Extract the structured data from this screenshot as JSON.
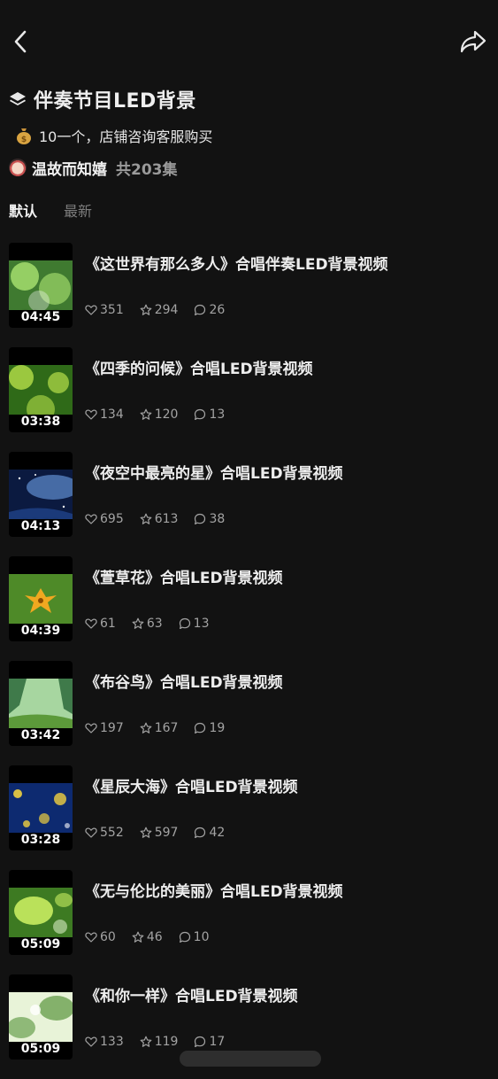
{
  "header": {
    "title": "伴奏节目LED背景",
    "description": "10一个，店铺咨询客服购买",
    "author": "温故而知嬉",
    "episode_count": "共203集"
  },
  "tabs": [
    {
      "label": "默认",
      "active": true
    },
    {
      "label": "最新",
      "active": false
    }
  ],
  "icons": {
    "back": "chevron-left-icon",
    "share": "share-arrow-icon",
    "title": "layers-icon",
    "description": "money-bag-icon",
    "like": "heart-icon",
    "favorite": "star-icon",
    "comment": "comment-icon"
  },
  "colors": {
    "background": "#121212",
    "text": "#e9e9e9",
    "muted": "#a3a3a3"
  },
  "items": [
    {
      "title": "《这世界有那么多人》合唱伴奏LED背景视频",
      "duration": "04:45",
      "likes": "351",
      "favorites": "294",
      "comments": "26",
      "thumb_colors": [
        "#9fd86a",
        "#3f7a30"
      ]
    },
    {
      "title": "《四季的问候》合唱LED背景视频",
      "duration": "03:38",
      "likes": "134",
      "favorites": "120",
      "comments": "13",
      "thumb_colors": [
        "#b6e04a",
        "#2f6a18"
      ]
    },
    {
      "title": "《夜空中最亮的星》合唱LED背景视频",
      "duration": "04:13",
      "likes": "695",
      "favorites": "613",
      "comments": "38",
      "thumb_colors": [
        "#5f8ed0",
        "#0b1a40"
      ]
    },
    {
      "title": "《萱草花》合唱LED背景视频",
      "duration": "04:39",
      "likes": "61",
      "favorites": "63",
      "comments": "13",
      "thumb_colors": [
        "#f0a820",
        "#4e8a28"
      ]
    },
    {
      "title": "《布谷鸟》合唱LED背景视频",
      "duration": "03:42",
      "likes": "197",
      "favorites": "167",
      "comments": "19",
      "thumb_colors": [
        "#a7d6a0",
        "#3f7a4a"
      ]
    },
    {
      "title": "《星辰大海》合唱LED背景视频",
      "duration": "03:28",
      "likes": "552",
      "favorites": "597",
      "comments": "42",
      "thumb_colors": [
        "#f0d040",
        "#0d2a70"
      ]
    },
    {
      "title": "《无与伦比的美丽》合唱LED背景视频",
      "duration": "05:09",
      "likes": "60",
      "favorites": "46",
      "comments": "10",
      "thumb_colors": [
        "#c8ec60",
        "#3d7a22"
      ]
    },
    {
      "title": "《和你一样》合唱LED背景视频",
      "duration": "05:09",
      "likes": "133",
      "favorites": "119",
      "comments": "17",
      "thumb_colors": [
        "#e8f3d8",
        "#6aa050"
      ]
    }
  ]
}
